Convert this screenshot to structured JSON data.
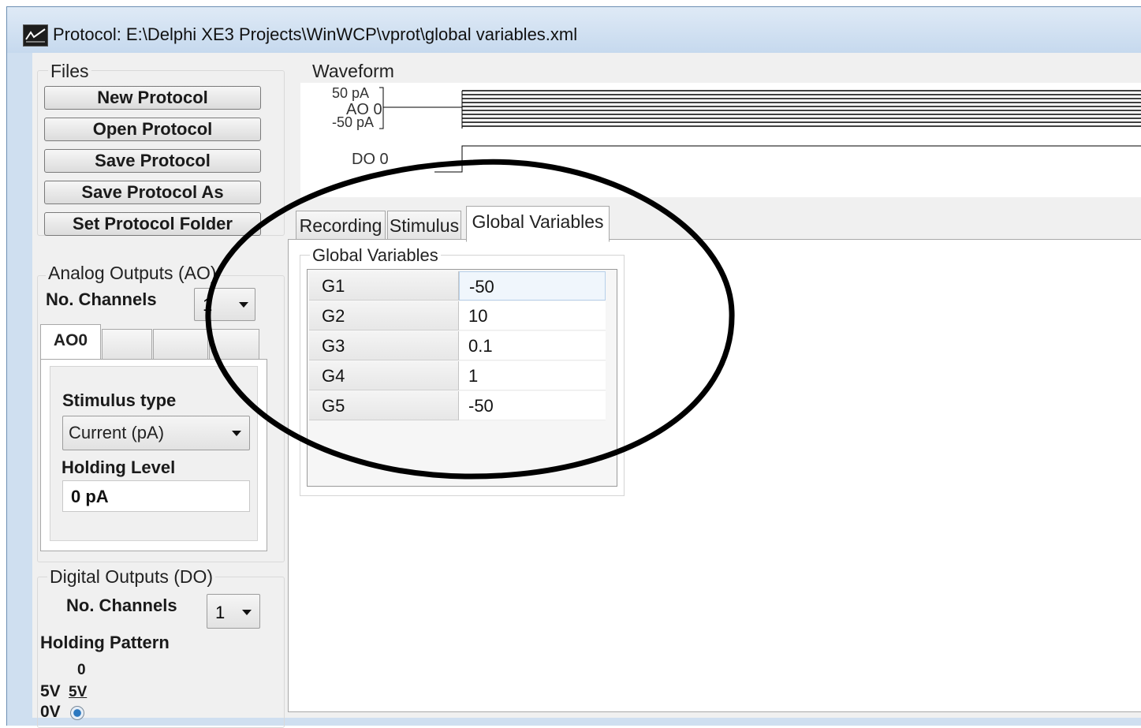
{
  "window": {
    "title": "Protocol: E:\\Delphi XE3 Projects\\WinWCP\\vprot\\global variables.xml"
  },
  "files": {
    "group_label": "Files",
    "buttons": [
      "New Protocol",
      "Open Protocol",
      "Save Protocol",
      "Save Protocol As",
      "Set Protocol Folder"
    ]
  },
  "analog_outputs": {
    "group_label": "Analog Outputs (AO)",
    "channels_label": "No. Channels",
    "channels_value": "1",
    "tabs": [
      "AO0",
      "",
      "",
      ""
    ],
    "stimulus_type_label": "Stimulus type",
    "stimulus_type_value": "Current (pA)",
    "holding_level_label": "Holding Level",
    "holding_level_value": "0 pA"
  },
  "digital_outputs": {
    "group_label": "Digital Outputs (DO)",
    "channels_label": "No. Channels",
    "channels_value": "1",
    "holding_pattern_label": "Holding Pattern",
    "bit_label": "0",
    "v5_label": "5V",
    "v5_option": "5V",
    "v0_label": "0V"
  },
  "waveform": {
    "label": "Waveform",
    "ao_top_label": "50 pA",
    "ao_channel_label": "AO 0",
    "ao_bottom_label": "-50 pA",
    "do_channel_label": "DO 0"
  },
  "tabs": {
    "items": [
      "Recording",
      "Stimulus",
      "Global Variables"
    ],
    "active": "Global Variables"
  },
  "global_variables": {
    "group_label": "Global Variables",
    "rows": [
      {
        "name": "G1",
        "value": "-50"
      },
      {
        "name": "G2",
        "value": "10"
      },
      {
        "name": "G3",
        "value": "0.1"
      },
      {
        "name": "G4",
        "value": "1"
      },
      {
        "name": "G5",
        "value": "-50"
      }
    ]
  },
  "colors": {
    "window_frame": "#cfdff0",
    "panel": "#f0f0f0",
    "annotation": "#000000"
  }
}
